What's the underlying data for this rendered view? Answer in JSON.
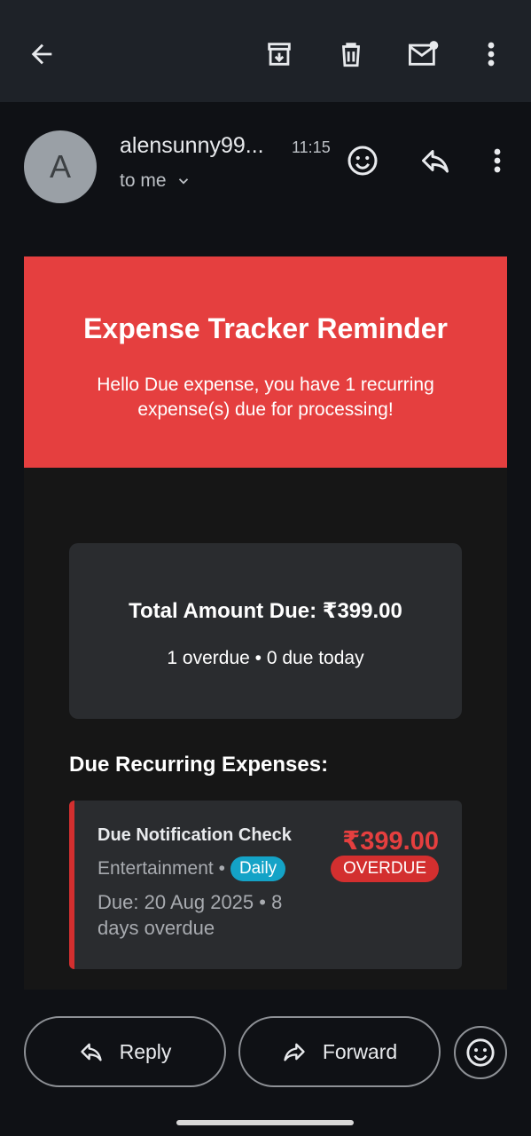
{
  "toolbar": {
    "back_icon": "arrow-left-icon",
    "archive_icon": "archive-icon",
    "delete_icon": "trash-icon",
    "mark_unread_icon": "mail-unread-icon",
    "more_icon": "more-vert-icon"
  },
  "message": {
    "avatar_letter": "A",
    "sender": "alensunny99...",
    "time": "11:15",
    "recipient": "to me"
  },
  "email": {
    "title": "Expense Tracker Reminder",
    "subtitle": "Hello Due expense, you have 1 recurring expense(s) due for processing!",
    "summary": {
      "total": "Total Amount Due: ₹399.00",
      "counts": "1 overdue • 0 due today"
    },
    "due_heading": "Due Recurring Expenses:",
    "expenses": [
      {
        "name": "Due Notification Check",
        "category": "Entertainment •",
        "frequency": "Daily",
        "due_text": "Due: 20 Aug 2025 • 8 days overdue",
        "amount": "₹399.00",
        "status": "OVERDUE"
      }
    ]
  },
  "actions": {
    "reply_label": "Reply",
    "forward_label": "Forward"
  },
  "colors": {
    "header_red": "#e53f3f",
    "overdue_red": "#d32f2f",
    "daily_badge": "#14a3c7"
  }
}
